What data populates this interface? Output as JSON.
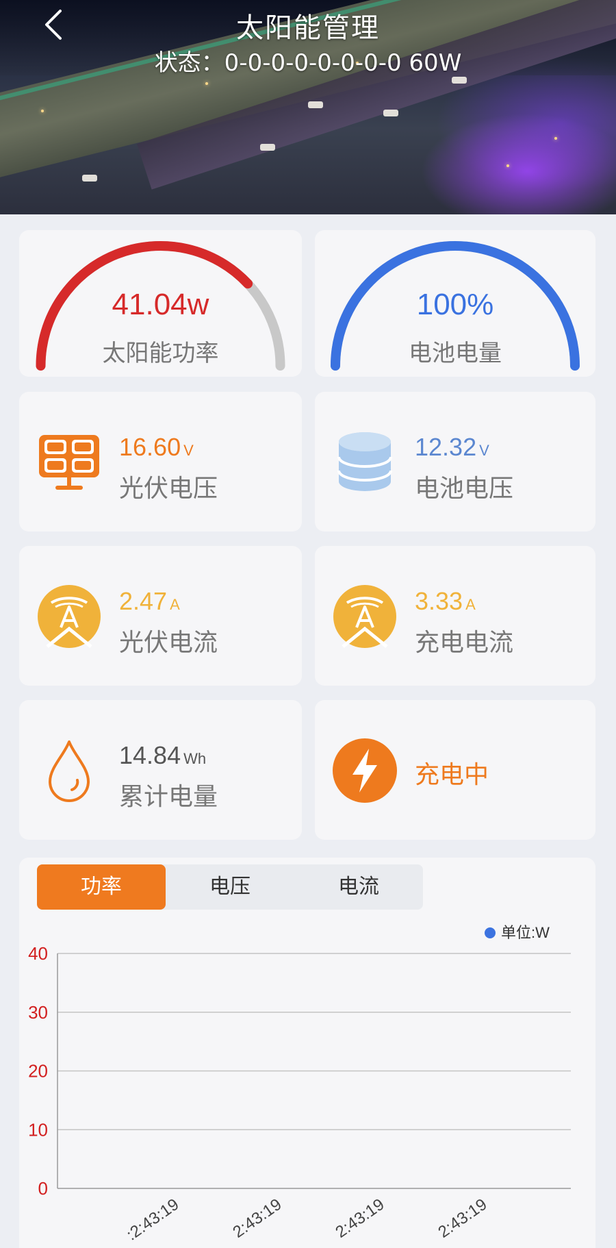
{
  "header": {
    "title": "太阳能管理",
    "status": "状态：0-0-0-0-0-0-0-0 60W"
  },
  "gauges": [
    {
      "value": "41.04w",
      "label": "太阳能功率",
      "fraction": 0.76,
      "color": "#d62a2a",
      "track": "#c8c8c8"
    },
    {
      "value": "100%",
      "label": "电池电量",
      "fraction": 1.0,
      "color": "#3a72e0",
      "track": "#c8c8c8"
    }
  ],
  "stats": {
    "pv_voltage": {
      "value": "16.60",
      "unit": "V",
      "label": "光伏电压",
      "color": "#ee7a1e",
      "icon": "solar-panel-icon"
    },
    "battery_voltage": {
      "value": "12.32",
      "unit": "V",
      "label": "电池电压",
      "color": "#5b87d0",
      "icon": "database-icon"
    },
    "pv_current": {
      "value": "2.47",
      "unit": "A",
      "label": "光伏电流",
      "color": "#f0b23a",
      "icon": "ampere-icon"
    },
    "charge_current": {
      "value": "3.33",
      "unit": "A",
      "label": "充电电流",
      "color": "#f0b23a",
      "icon": "ampere-icon"
    },
    "total_energy": {
      "value": "14.84",
      "unit": "Wh",
      "label": "累计电量",
      "color": "#555555",
      "icon": "drop-icon"
    },
    "charging": {
      "label": "充电中",
      "icon": "lightning-icon",
      "color": "#ee7a1e"
    }
  },
  "chart_tabs": [
    "功率",
    "电压",
    "电流"
  ],
  "chart_data": {
    "type": "line",
    "legend": "单位:W",
    "ylim": [
      0,
      40
    ],
    "yticks": [
      "0",
      "10",
      "20",
      "30",
      "40"
    ],
    "xticks": [
      ":2:43:19",
      "2:43:19",
      "2:43:19",
      "2:43:19"
    ],
    "series": [
      {
        "name": "单位:W",
        "values": []
      }
    ],
    "grid": true,
    "legend_position": "top-right"
  }
}
